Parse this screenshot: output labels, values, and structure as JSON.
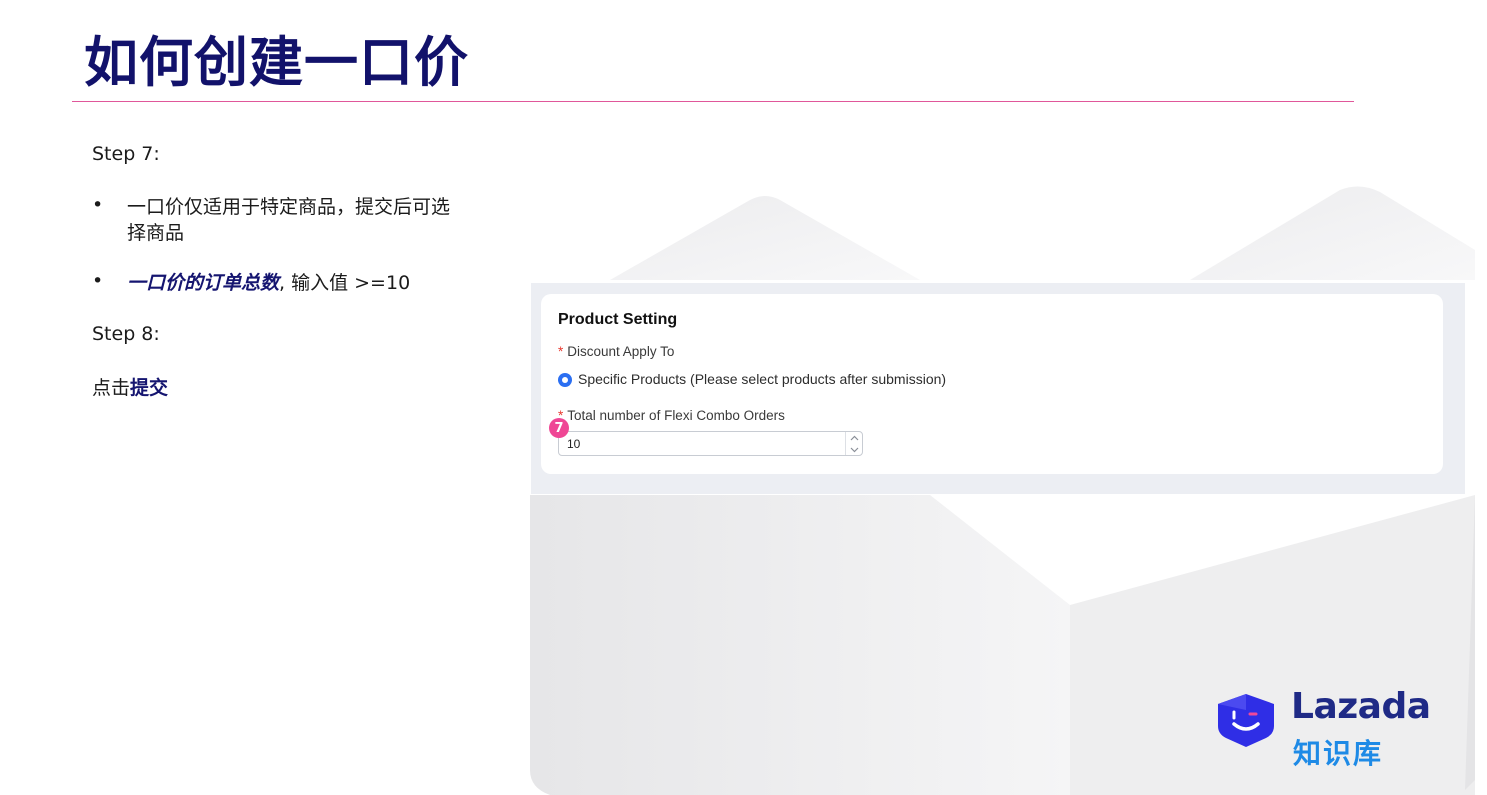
{
  "title": "如何创建一口价",
  "left": {
    "step7": "Step 7:",
    "bullet_char": "•",
    "bullet1": "一口价仅适用于特定商品，提交后可选择商品",
    "bullet2_em": "一口价的订单总数",
    "bullet2_rest": ", 输入值 >=10",
    "step8": "Step 8:",
    "click_prefix": "点击",
    "click_strong": "提交"
  },
  "form": {
    "title": "Product Setting",
    "required_mark": "*",
    "discount_label": "Discount Apply To",
    "radio_label": "Specific Products (Please select products after submission)",
    "radio_selected": true,
    "orders_label": "Total number of Flexi Combo Orders",
    "orders_value": "10",
    "badge": "7"
  },
  "logo": {
    "word": "Lazada",
    "sub": "知识库",
    "colors": {
      "mark": "#2f2ee6",
      "word": "#1f2a86",
      "sub": "#1e8ae6"
    }
  },
  "colors": {
    "title": "#12126b",
    "rule": "#e0579a",
    "badge": "#ef4795",
    "radio": "#2b6ff2"
  }
}
